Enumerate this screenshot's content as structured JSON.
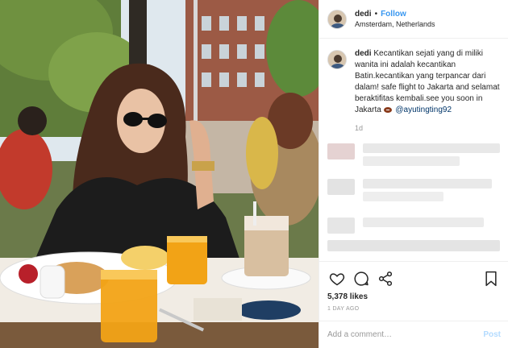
{
  "header": {
    "username": "dedi",
    "separator": "•",
    "follow_label": "Follow",
    "location": "Amsterdam, Netherlands"
  },
  "caption": {
    "username": "dedi",
    "text": "Kecantikan sejati yang di miliki wanita ini adalah kecantikan Batin.kecantikan yang terpancar dari dalam! safe flight to Jakarta and selamat beraktifitas kembali.see you soon in Jakarta",
    "mention": "@ayutingting92",
    "time": "1d"
  },
  "actions": {
    "like_icon": "heart-icon",
    "comment_icon": "comment-icon",
    "share_icon": "share-icon",
    "save_icon": "bookmark-icon",
    "likes_count": "5,378",
    "likes_suffix": " likes",
    "date": "1 DAY AGO"
  },
  "comment_box": {
    "placeholder": "Add a comment…",
    "post_label": "Post"
  },
  "colors": {
    "link_blue": "#3897f0",
    "post_disabled": "#b3dbff",
    "mention": "#003569",
    "muted": "#999999"
  }
}
